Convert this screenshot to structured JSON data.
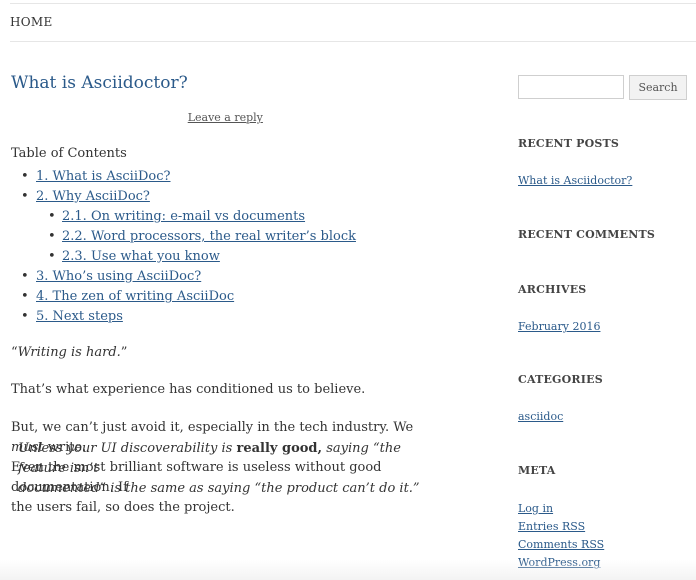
{
  "nav": {
    "home": "HOME"
  },
  "post": {
    "title": "What is Asciidoctor?",
    "leave_reply": "Leave a reply",
    "toc_title": "Table of Contents",
    "toc": [
      {
        "label": "1. What is AsciiDoc?"
      },
      {
        "label": "2. Why AsciiDoc?",
        "children": [
          {
            "label": "2.1. On writing: e-mail vs documents"
          },
          {
            "label": "2.2. Word processors, the real writer’s block"
          },
          {
            "label": "2.3. Use what you know"
          }
        ]
      },
      {
        "label": "3. Who’s using AsciiDoc?"
      },
      {
        "label": "4. The zen of writing AsciiDoc"
      },
      {
        "label": "5. Next steps"
      }
    ],
    "quote_open": "“",
    "quote_text": "Writing is hard.",
    "quote_close": "”",
    "para1": "That’s what experience has conditioned us to believe.",
    "para2_a": "But, we can’t just avoid it, especially in the tech industry. We ",
    "para2_em": "must",
    "para2_b": " write.",
    "para2_line2": "Even the most brilliant software is useless without good documentation. If",
    "para2_line3": "the users fail, so does the project.",
    "block_a": "Unless your UI discoverability is ",
    "block_bold": "really good,",
    "block_b": " saying “the feature isn’t",
    "block_line2": "documented” is the same as saying “the product can’t do it.”"
  },
  "sidebar": {
    "search_button": "Search",
    "search_placeholder": "",
    "recent_posts_heading": "RECENT POSTS",
    "recent_post": "What is Asciidoctor?",
    "recent_comments_heading": "RECENT COMMENTS",
    "archives_heading": "ARCHIVES",
    "archive": "February 2016",
    "categories_heading": "CATEGORIES",
    "category": "asciidoc",
    "meta_heading": "META",
    "meta_links": [
      "Log in",
      "Entries RSS",
      "Comments RSS",
      "WordPress.org"
    ]
  }
}
